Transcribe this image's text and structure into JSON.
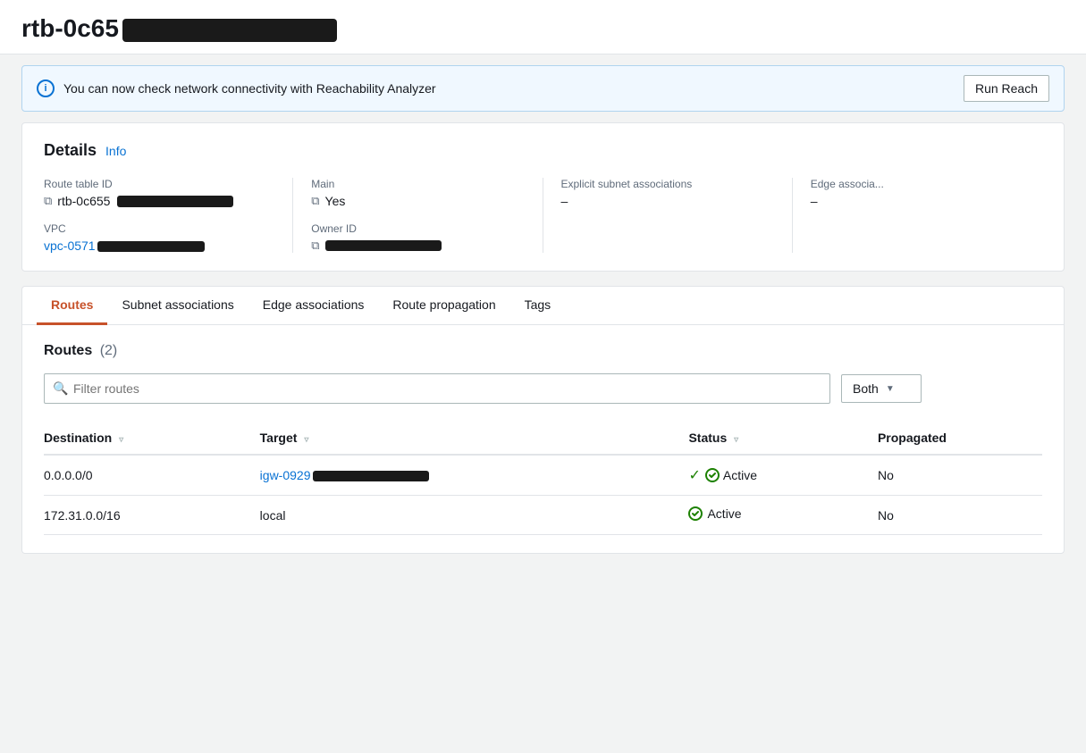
{
  "page": {
    "title_prefix": "rtb-0c65",
    "title_redacted": true
  },
  "banner": {
    "text": "You can now check network connectivity with Reachability Analyzer",
    "button_label": "Run Reach"
  },
  "details": {
    "section_title": "Details",
    "info_link": "Info",
    "route_table_id_label": "Route table ID",
    "route_table_id_prefix": "rtb-0c655",
    "main_label": "Main",
    "main_value": "Yes",
    "explicit_subnet_label": "Explicit subnet associations",
    "explicit_subnet_value": "–",
    "edge_assoc_label": "Edge associa...",
    "edge_assoc_value": "–",
    "vpc_label": "VPC",
    "vpc_prefix": "vpc-0571",
    "owner_id_label": "Owner ID"
  },
  "tabs": [
    {
      "id": "routes",
      "label": "Routes",
      "active": true
    },
    {
      "id": "subnet-associations",
      "label": "Subnet associations",
      "active": false
    },
    {
      "id": "edge-associations",
      "label": "Edge associations",
      "active": false
    },
    {
      "id": "route-propagation",
      "label": "Route propagation",
      "active": false
    },
    {
      "id": "tags",
      "label": "Tags",
      "active": false
    }
  ],
  "routes_section": {
    "title": "Routes",
    "count": "(2)",
    "filter_placeholder": "Filter routes",
    "dropdown_label": "Both",
    "columns": [
      {
        "id": "destination",
        "label": "Destination"
      },
      {
        "id": "target",
        "label": "Target"
      },
      {
        "id": "status",
        "label": "Status"
      },
      {
        "id": "propagated",
        "label": "Propagated"
      }
    ],
    "rows": [
      {
        "destination": "0.0.0.0/0",
        "target_prefix": "igw-0929",
        "target_redacted": true,
        "status": "Active",
        "propagated": "No"
      },
      {
        "destination": "172.31.0.0/16",
        "target": "local",
        "target_redacted": false,
        "status": "Active",
        "propagated": "No"
      }
    ]
  }
}
